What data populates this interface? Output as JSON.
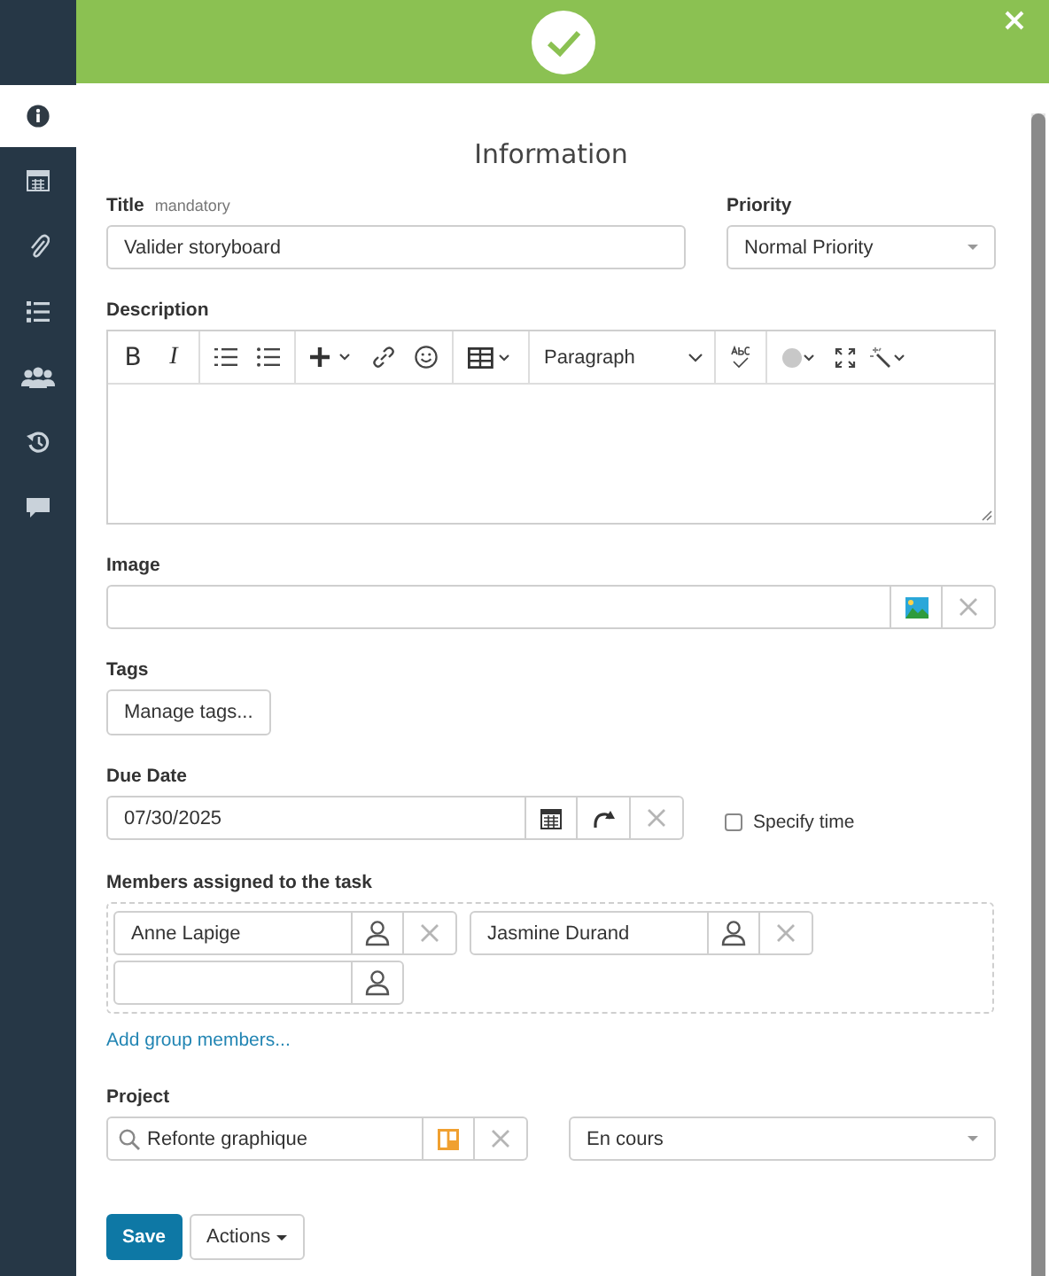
{
  "sidebar": {
    "items": [
      {
        "kind": "info",
        "selected": true
      },
      {
        "kind": "calendar",
        "selected": false
      },
      {
        "kind": "attachment",
        "selected": false
      },
      {
        "kind": "list",
        "selected": false
      },
      {
        "kind": "people",
        "selected": false
      },
      {
        "kind": "history",
        "selected": false
      },
      {
        "kind": "comment",
        "selected": false
      }
    ]
  },
  "heading": "Information",
  "title_field": {
    "label": "Title",
    "hint": "mandatory",
    "value": "Valider storyboard"
  },
  "priority": {
    "label": "Priority",
    "value": "Normal Priority"
  },
  "description": {
    "label": "Description",
    "bold": "B",
    "italic": "I",
    "block_format": "Paragraph"
  },
  "image": {
    "label": "Image"
  },
  "tags": {
    "label": "Tags",
    "button": "Manage tags..."
  },
  "due_date": {
    "label": "Due Date",
    "value": "07/30/2025",
    "specify_time": {
      "label": "Specify time",
      "checked": false
    }
  },
  "members": {
    "label": "Members assigned to the task",
    "items": [
      {
        "name": "Anne Lapige"
      },
      {
        "name": "Jasmine Durand"
      }
    ],
    "add_group": "Add group members..."
  },
  "project": {
    "label": "Project",
    "value": "Refonte graphique",
    "status": "En cours"
  },
  "buttons": {
    "save": "Save",
    "actions": "Actions"
  }
}
